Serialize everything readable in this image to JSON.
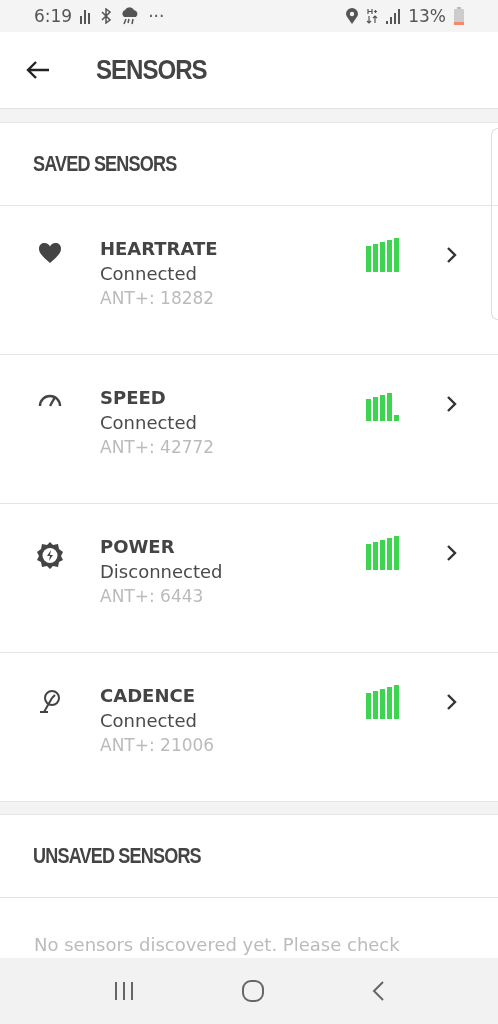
{
  "status_bar": {
    "time": "6:19",
    "more": "···",
    "battery": "13%"
  },
  "header": {
    "title": "SENSORS"
  },
  "saved": {
    "title": "SAVED SENSORS",
    "sensors": [
      {
        "kind": "heart",
        "name": "HEARTRATE",
        "status": "Connected",
        "id": "ANT+: 18282",
        "weak_signal": false
      },
      {
        "kind": "speed",
        "name": "SPEED",
        "status": "Connected",
        "id": "ANT+: 42772",
        "weak_signal": true
      },
      {
        "kind": "power",
        "name": "POWER",
        "status": "Disconnected",
        "id": "ANT+: 6443",
        "weak_signal": false
      },
      {
        "kind": "cadence",
        "name": "CADENCE",
        "status": "Connected",
        "id": "ANT+: 21006",
        "weak_signal": false
      }
    ]
  },
  "unsaved": {
    "title": "UNSAVED SENSORS",
    "message": "No sensors discovered yet. Please check"
  }
}
